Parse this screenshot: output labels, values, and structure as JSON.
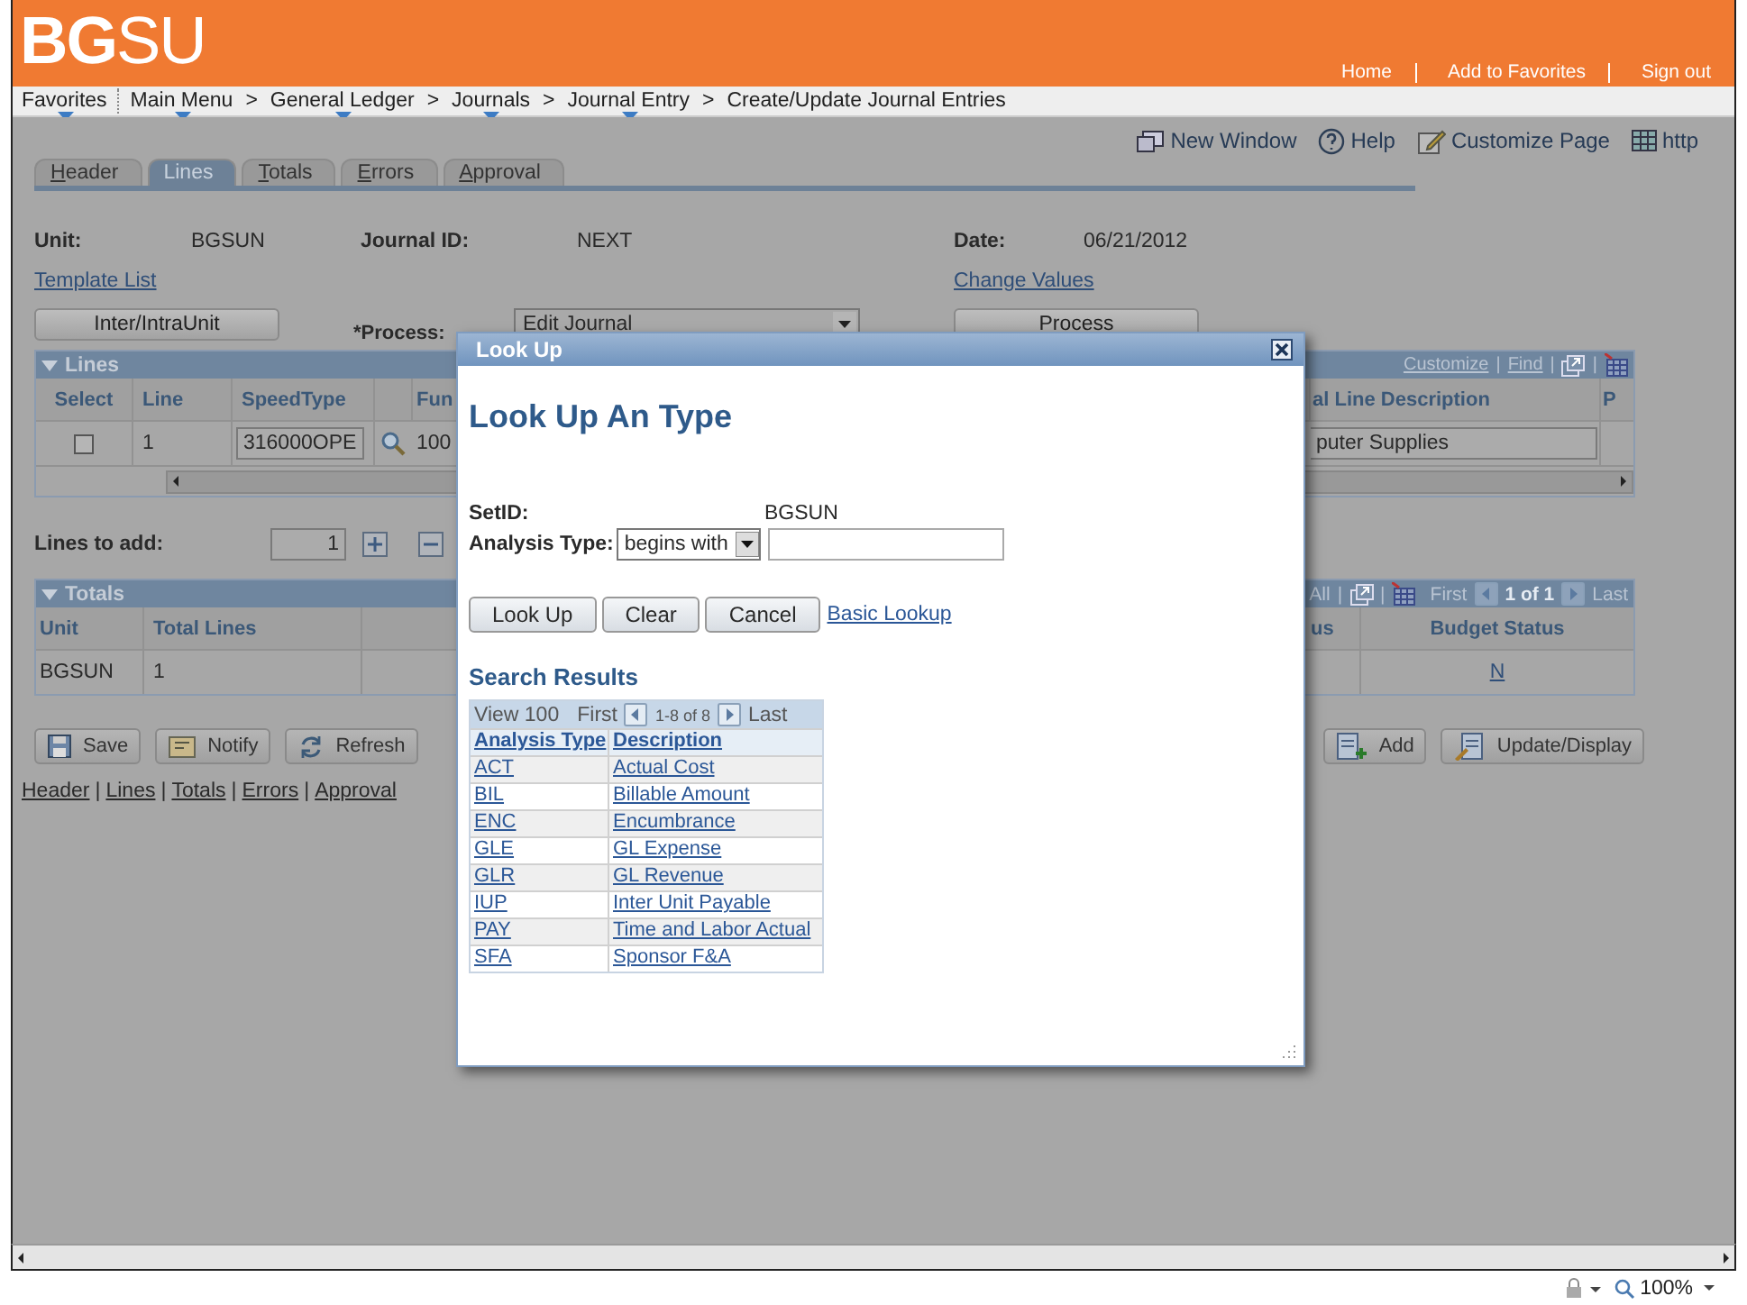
{
  "header": {
    "logo_bold": "BG",
    "logo_light": "SU",
    "links": [
      "Home",
      "Add to Favorites",
      "Sign out"
    ]
  },
  "breadcrumb": {
    "separator": ">",
    "items": [
      {
        "label": "Favorites",
        "menu": true
      },
      {
        "label": "Main Menu",
        "menu": true
      },
      {
        "label": "General Ledger",
        "menu": true
      },
      {
        "label": "Journals",
        "menu": true
      },
      {
        "label": "Journal Entry",
        "menu": true
      },
      {
        "label": "Create/Update Journal Entries",
        "menu": false
      }
    ]
  },
  "toolbar": [
    {
      "kind": "new_window",
      "label": "New Window"
    },
    {
      "kind": "help",
      "label": "Help"
    },
    {
      "kind": "customize",
      "label": "Customize Page"
    },
    {
      "kind": "http",
      "label": "http"
    }
  ],
  "tabs": [
    {
      "label": "Header",
      "selected": false
    },
    {
      "label": "Lines",
      "selected": true
    },
    {
      "label": "Totals",
      "selected": false
    },
    {
      "label": "Errors",
      "selected": false
    },
    {
      "label": "Approval",
      "selected": false
    }
  ],
  "form": {
    "unit_label": "Unit:",
    "unit": "BGSUN",
    "journal_id_label": "Journal ID:",
    "journal_id": "NEXT",
    "date_label": "Date:",
    "date": "06/21/2012",
    "template_link": "Template List",
    "change_values_link": "Change Values",
    "inter_button": "Inter/IntraUnit",
    "process_label": "*Process:",
    "process_value": "Edit Journal",
    "process_button": "Process"
  },
  "lines_grid": {
    "title": "Lines",
    "tools": [
      "Customize",
      "Find"
    ],
    "separator": "|",
    "columns": {
      "select": "Select",
      "line": "Line",
      "speedtype": "SpeedType",
      "column_5": "Fun",
      "column_6": "al Line Description",
      "column_7": "P"
    },
    "row": {
      "checked": false,
      "line": "1",
      "speedtype": "316000OPE",
      "column_5": "100",
      "column_6": "puter Supplies"
    }
  },
  "lines_to_add": {
    "label": "Lines to add:",
    "value": "1"
  },
  "totals_grid": {
    "title": "Totals",
    "separator": "|",
    "nav": {
      "column_1": "All",
      "first": "First",
      "range": "1 of 1",
      "last": "Last"
    },
    "columns": {
      "unit": "Unit",
      "total_lines": "Total Lines",
      "column_3": "us",
      "budget_status": "Budget Status"
    },
    "row": {
      "unit": "BGSUN",
      "total_lines": "1",
      "budget_status": "N"
    }
  },
  "actions_left": [
    {
      "kind": "save",
      "label": "Save"
    },
    {
      "kind": "notify",
      "label": "Notify"
    },
    {
      "kind": "refresh",
      "label": "Refresh"
    }
  ],
  "actions_right": [
    {
      "kind": "add",
      "label": "Add"
    },
    {
      "kind": "update",
      "label": "Update/Display"
    }
  ],
  "footer_links": {
    "separator": "|",
    "items": [
      "Header",
      "Lines",
      "Totals",
      "Errors",
      "Approval"
    ]
  },
  "dialog": {
    "title": "Look Up",
    "heading": "Look Up An Type",
    "setid_label": "SetID:",
    "setid": "BGSUN",
    "field_label": "Analysis Type:",
    "operator": "begins with",
    "buttons": [
      "Look Up",
      "Clear",
      "Cancel"
    ],
    "basic_link": "Basic Lookup",
    "results_title": "Search Results",
    "nav": {
      "view": "View 100",
      "first": "First",
      "range": "1-8 of 8",
      "last": "Last"
    },
    "columns": [
      "Analysis Type",
      "Description"
    ],
    "rows": [
      {
        "type": "ACT",
        "description": "Actual Cost"
      },
      {
        "type": "BIL",
        "description": "Billable Amount"
      },
      {
        "type": "ENC",
        "description": "Encumbrance"
      },
      {
        "type": "GLE",
        "description": "GL Expense"
      },
      {
        "type": "GLR",
        "description": "GL Revenue"
      },
      {
        "type": "IUP",
        "description": "Inter Unit Payable"
      },
      {
        "type": "PAY",
        "description": "Time and Labor Actual"
      },
      {
        "type": "SFA",
        "description": "Sponsor F&A"
      }
    ]
  },
  "status_bar": {
    "zoom": "100%"
  }
}
